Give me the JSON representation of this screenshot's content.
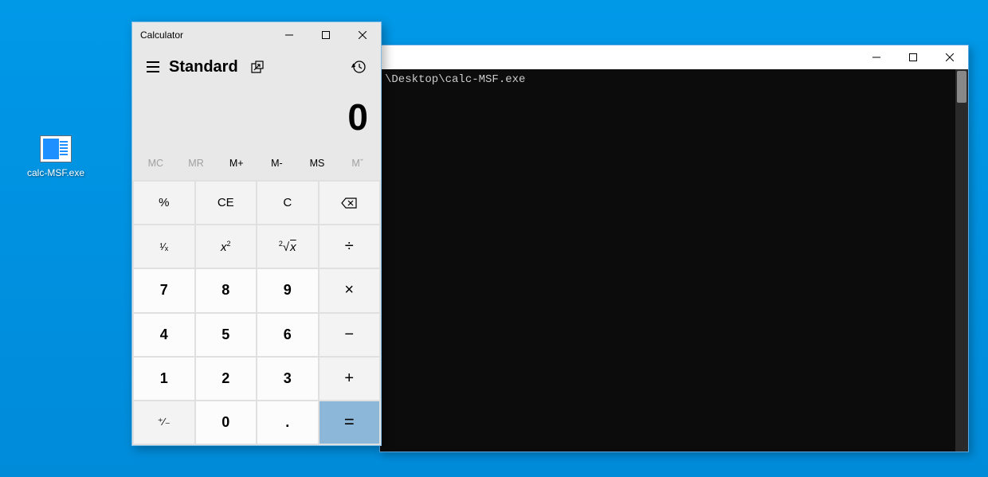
{
  "desktop": {
    "icon_label": "calc-MSF.exe"
  },
  "console": {
    "title": "",
    "line1": "\\Desktop\\calc-MSF.exe"
  },
  "calc": {
    "title": "Calculator",
    "mode": "Standard",
    "display": "0",
    "memory": {
      "mc": "MC",
      "mr": "MR",
      "mplus": "M+",
      "mminus": "M-",
      "ms": "MS",
      "mlist": "Mˇ"
    },
    "keys": {
      "percent": "%",
      "ce": "CE",
      "c": "C",
      "reciprocal": "¹⁄ₓ",
      "square": "x²",
      "sqrt": "²√x",
      "divide": "÷",
      "multiply": "×",
      "minus": "−",
      "plus": "+",
      "equals": "=",
      "negate": "⁺⁄₋",
      "dot": ".",
      "n0": "0",
      "n1": "1",
      "n2": "2",
      "n3": "3",
      "n4": "4",
      "n5": "5",
      "n6": "6",
      "n7": "7",
      "n8": "8",
      "n9": "9"
    }
  }
}
